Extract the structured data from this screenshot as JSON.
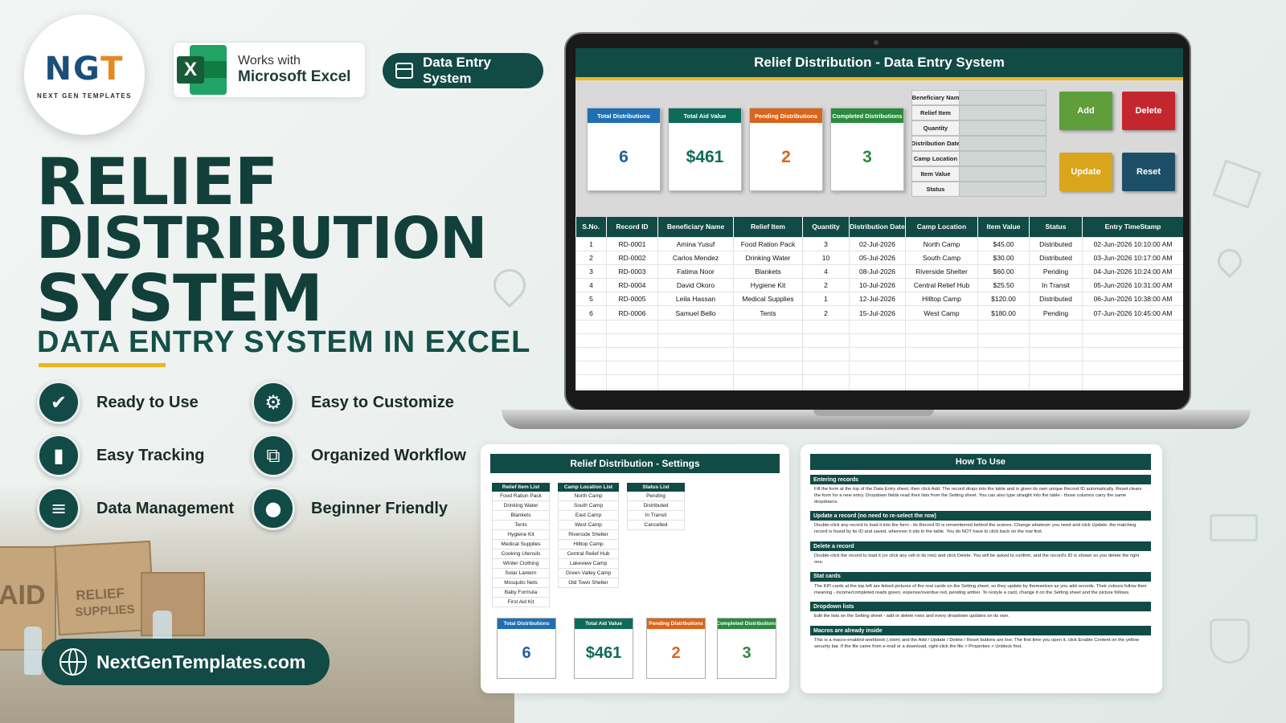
{
  "logo": {
    "mark_a": "NG",
    "mark_b": "T",
    "sub": "NEXT GEN TEMPLATES"
  },
  "excel_badge": {
    "line1": "Works with",
    "line2": "Microsoft Excel",
    "icon_letter": "X"
  },
  "pill": {
    "label": "Data Entry System"
  },
  "title": {
    "line1": "RELIEF",
    "line2": "DISTRIBUTION",
    "line3": "SYSTEM",
    "subtitle": "DATA ENTRY SYSTEM IN EXCEL"
  },
  "features": [
    {
      "label": "Ready to Use",
      "icon": "check-icon"
    },
    {
      "label": "Easy to Customize",
      "icon": "gear-icon"
    },
    {
      "label": "Easy Tracking",
      "icon": "bar-chart-icon"
    },
    {
      "label": "Organized Workflow",
      "icon": "workflow-icon"
    },
    {
      "label": "Data Management",
      "icon": "database-icon"
    },
    {
      "label": "Beginner Friendly",
      "icon": "user-icon"
    }
  ],
  "website": "NextGenTemplates.com",
  "boxes": {
    "aid": "AID",
    "relief": "RELIEF",
    "supplies": "SUPPLIES"
  },
  "screen": {
    "title": "Relief Distribution - Data Entry System",
    "kpis": [
      {
        "label": "Total Distributions",
        "value": "6",
        "color": "#1f6fb2",
        "value_color": "#1f5f9e"
      },
      {
        "label": "Total Aid Value",
        "value": "$461",
        "color": "#0e6b5a",
        "value_color": "#0e6b5a"
      },
      {
        "label": "Pending Distributions",
        "value": "2",
        "color": "#d9641c",
        "value_color": "#d9641c"
      },
      {
        "label": "Completed Distributions",
        "value": "3",
        "color": "#2b8a3e",
        "value_color": "#2b8a3e"
      }
    ],
    "form_fields": [
      "Beneficiary Nam",
      "Relief Item",
      "Quantity",
      "Distribution Date",
      "Camp Location",
      "Item Value",
      "Status"
    ],
    "buttons": [
      {
        "label": "Add",
        "color": "#5f9e3a"
      },
      {
        "label": "Delete",
        "color": "#c4262e"
      },
      {
        "label": "Update",
        "color": "#d9a51b"
      },
      {
        "label": "Reset",
        "color": "#1d4e68"
      }
    ],
    "table": {
      "headers": [
        "S.No.",
        "Record ID",
        "Beneficiary Name",
        "Relief Item",
        "Quantity",
        "Distribution Date",
        "Camp Location",
        "Item Value",
        "Status",
        "Entry TimeStamp"
      ],
      "rows": [
        [
          "1",
          "RD-0001",
          "Amina Yusuf",
          "Food Ration Pack",
          "3",
          "02-Jul-2026",
          "North Camp",
          "$45.00",
          "Distributed",
          "02-Jun-2026 10:10:00 AM"
        ],
        [
          "2",
          "RD-0002",
          "Carlos Mendez",
          "Drinking Water",
          "10",
          "05-Jul-2026",
          "South Camp",
          "$30.00",
          "Distributed",
          "03-Jun-2026 10:17:00 AM"
        ],
        [
          "3",
          "RD-0003",
          "Fatima Noor",
          "Blankets",
          "4",
          "08-Jul-2026",
          "Riverside Shelter",
          "$60.00",
          "Pending",
          "04-Jun-2026 10:24:00 AM"
        ],
        [
          "4",
          "RD-0004",
          "David Okoro",
          "Hygiene Kit",
          "2",
          "10-Jul-2026",
          "Central Relief Hub",
          "$25.50",
          "In Transit",
          "05-Jun-2026 10:31:00 AM"
        ],
        [
          "5",
          "RD-0005",
          "Leila Hassan",
          "Medical Supplies",
          "1",
          "12-Jul-2026",
          "Hilltop Camp",
          "$120.00",
          "Distributed",
          "06-Jun-2026 10:38:00 AM"
        ],
        [
          "6",
          "RD-0006",
          "Samuel Bello",
          "Tents",
          "2",
          "15-Jul-2026",
          "West Camp",
          "$180.00",
          "Pending",
          "07-Jun-2026 10:45:00 AM"
        ]
      ]
    }
  },
  "settings": {
    "title": "Relief Distribution - Settings",
    "relief_items": {
      "header": "Relief Item List",
      "items": [
        "Food Ration Pack",
        "Drinking Water",
        "Blankets",
        "Tents",
        "Hygiene Kit",
        "Medical Supplies",
        "Cooking Utensils",
        "Winter Clothing",
        "Solar Lantern",
        "Mosquito Nets",
        "Baby Formula",
        "First Aid Kit"
      ]
    },
    "camp_locations": {
      "header": "Camp Location List",
      "items": [
        "North Camp",
        "South Camp",
        "East Camp",
        "West Camp",
        "Riverside Shelter",
        "Hilltop Camp",
        "Central Relief Hub",
        "Lakeview Camp",
        "Green Valley Camp",
        "Old Town Shelter"
      ]
    },
    "statuses": {
      "header": "Status List",
      "items": [
        "Pending",
        "Distributed",
        "In Transit",
        "Cancelled"
      ]
    },
    "kpis": [
      {
        "label": "Total Distributions",
        "value": "6",
        "color": "#1f6fb2",
        "value_color": "#1f5f9e"
      },
      {
        "label": "Total Aid Value",
        "value": "$461",
        "color": "#0e6b5a",
        "value_color": "#0e6b5a"
      },
      {
        "label": "Pending Distributions",
        "value": "2",
        "color": "#d9641c",
        "value_color": "#d9641c"
      },
      {
        "label": "Completed Distributions",
        "value": "3",
        "color": "#2b8a3e",
        "value_color": "#2b8a3e"
      }
    ]
  },
  "howto": {
    "title": "How To Use",
    "sections": [
      {
        "heading": "Entering records",
        "body": "Fill the form at the top of the Data Entry sheet, then click Add. The record drops into the table and is given its own unique Record ID automatically. Reset clears the form for a new entry. Dropdown fields read their lists from the Setting sheet. You can also type straight into the table - those columns carry the same dropdowns."
      },
      {
        "heading": "Update a record (no need to re-select the row)",
        "body": "Double-click any record to load it into the form - its Record ID is remembered behind the scenes. Change whatever you need and click Update: the matching record is found by its ID and saved, wherever it sits in the table. You do NOT have to click back on the row first."
      },
      {
        "heading": "Delete a record",
        "body": "Double-click the record to load it (or click any cell in its row) and click Delete. You will be asked to confirm, and the record's ID is shown so you delete the right one."
      },
      {
        "heading": "Stat cards",
        "body": "The KPI cards at the top left are linked pictures of the real cards on the Setting sheet, so they update by themselves as you add records. Their colours follow their meaning - income/completed reads green, expense/overdue red, pending amber. To restyle a card, change it on the Setting sheet and the picture follows."
      },
      {
        "heading": "Dropdown lists",
        "body": "Edit the lists on the Setting sheet - add or delete rows and every dropdown updates on its own."
      },
      {
        "heading": "Macros are already inside",
        "body": "This is a macro-enabled workbook (.xlsm) and the Add / Update / Delete / Reset buttons are live. The first time you open it, click Enable Content on the yellow security bar. If the file came from e-mail or a download, right-click the file > Properties > Unblock first."
      }
    ]
  },
  "colors": {
    "brand": "#124a45",
    "accent": "#f0b51b"
  }
}
